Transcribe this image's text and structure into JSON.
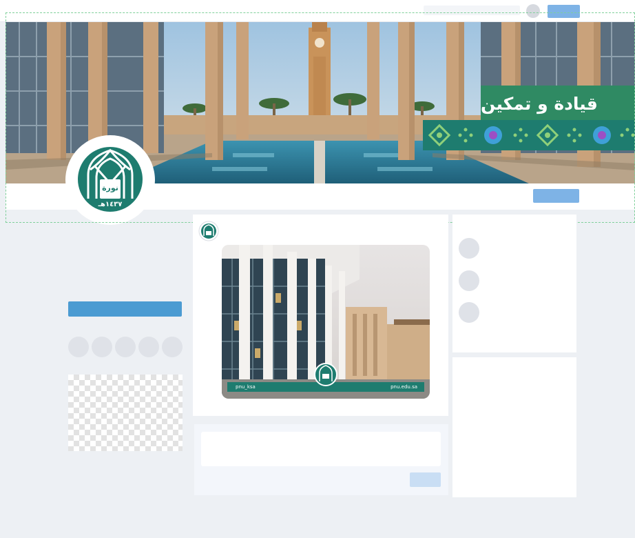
{
  "cover": {
    "banner_text": "قيادة و تمكين"
  },
  "post": {
    "image_footer_left": "pnu_ksa",
    "image_footer_right": "pnu.edu.sa"
  },
  "logo": {
    "emblem_text": "نورة",
    "emblem_year": "١٤٣٧هـ"
  },
  "colors": {
    "teal": "#1e7c6f",
    "accent_blue": "#4b9bd2",
    "light_blue": "#7eb3e6",
    "page_bg": "#edf0f4"
  }
}
